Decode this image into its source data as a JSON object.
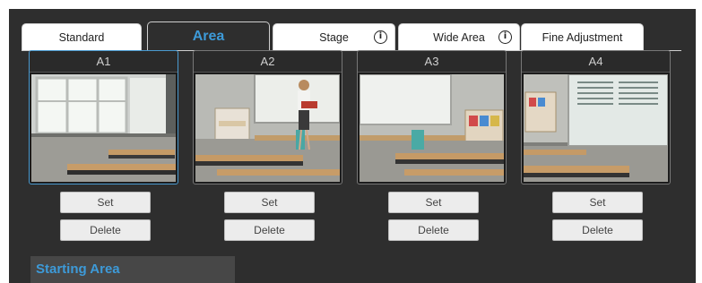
{
  "tabs": [
    {
      "label": "Standard",
      "active": false,
      "info": false
    },
    {
      "label": "Area",
      "active": true,
      "info": false
    },
    {
      "label": "Stage",
      "active": false,
      "info": true
    },
    {
      "label": "Wide Area",
      "active": false,
      "info": true
    },
    {
      "label": "Fine Adjustment",
      "active": false,
      "info": false
    }
  ],
  "info_glyph": "i",
  "presets": [
    {
      "title": "A1",
      "selected": true,
      "set_label": "Set",
      "delete_label": "Delete"
    },
    {
      "title": "A2",
      "selected": false,
      "set_label": "Set",
      "delete_label": "Delete"
    },
    {
      "title": "A3",
      "selected": false,
      "set_label": "Set",
      "delete_label": "Delete"
    },
    {
      "title": "A4",
      "selected": false,
      "set_label": "Set",
      "delete_label": "Delete"
    }
  ],
  "starting_area": {
    "label": "Starting Area"
  },
  "colors": {
    "accent": "#3d9ad8",
    "panel": "#2e2e2e",
    "button": "#ececec"
  }
}
